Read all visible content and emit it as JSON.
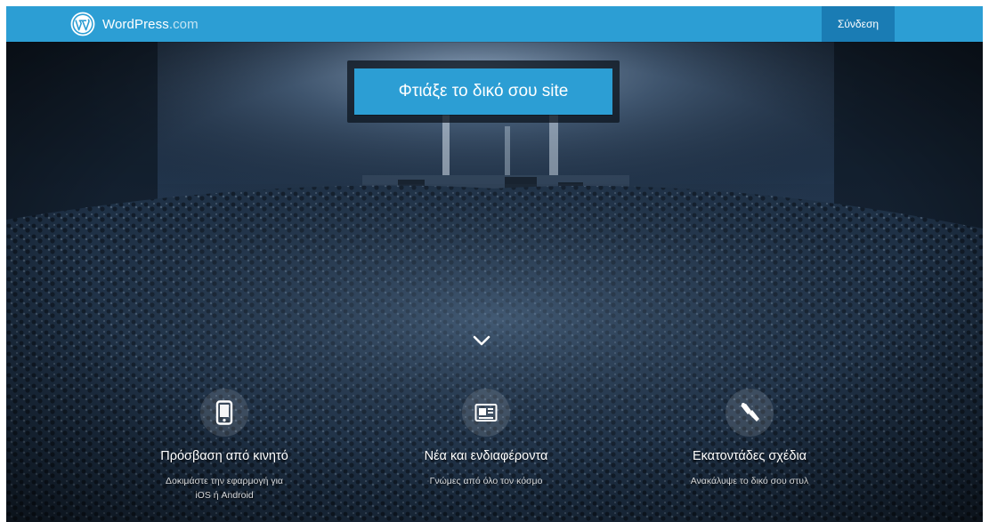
{
  "header": {
    "brand_main": "WordPress",
    "brand_suffix": ".com",
    "login_label": "Σύνδεση"
  },
  "hero": {
    "cta_label": "Φτιάξε το δικό σου site",
    "scroll_icon": "chevron-down-icon"
  },
  "features": [
    {
      "icon": "mobile-phone-icon",
      "title": "Πρόσβαση από κινητό",
      "desc": "Δοκιμάστε την εφαρμογή για iOS ή Android"
    },
    {
      "icon": "reader-icon",
      "title": "Νέα και ενδιαφέροντα",
      "desc": "Γνώμες από όλο τον κόσμο"
    },
    {
      "icon": "paint-brush-icon",
      "title": "Εκατοντάδες σχέδια",
      "desc": "Ανακάλυψε το δικό σου στυλ"
    }
  ],
  "colors": {
    "brand_blue": "#2c9ed4",
    "login_bg": "#1a7cb4",
    "hero_dark": "#16243a"
  }
}
